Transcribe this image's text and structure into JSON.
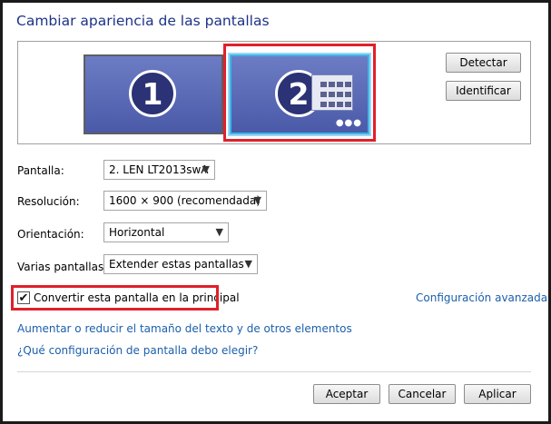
{
  "window": {
    "title": "Cambiar apariencia de las pantallas"
  },
  "preview": {
    "monitors": [
      {
        "number": "1",
        "selected": false
      },
      {
        "number": "2",
        "selected": true
      }
    ],
    "dots": "●●●",
    "detect_label": "Detectar",
    "identify_label": "Identificar"
  },
  "form": {
    "display": {
      "label": "Pantalla:",
      "value": "2. LEN LT2013swA"
    },
    "resolution": {
      "label": "Resolución:",
      "value": "1600 × 900 (recomendada)"
    },
    "orientation": {
      "label": "Orientación:",
      "value": "Horizontal"
    },
    "multiple": {
      "label": "Varias pantallas:",
      "value": "Extender estas pantallas"
    }
  },
  "primary": {
    "checked": true,
    "label": "Convertir esta pantalla en la principal"
  },
  "links": {
    "advanced": "Configuración avanzada",
    "text_size": "Aumentar o reducir el tamaño del texto y de otros elementos",
    "which_setting": "¿Qué configuración de pantalla debo elegir?"
  },
  "footer": {
    "accept": "Aceptar",
    "cancel": "Cancelar",
    "apply": "Aplicar"
  },
  "colors": {
    "title": "#1e3287",
    "link": "#1b5fab",
    "highlight": "#e0202b",
    "monitor": "#4a5aa8"
  },
  "icons": {
    "dropdown": "▼",
    "check": "✔"
  }
}
